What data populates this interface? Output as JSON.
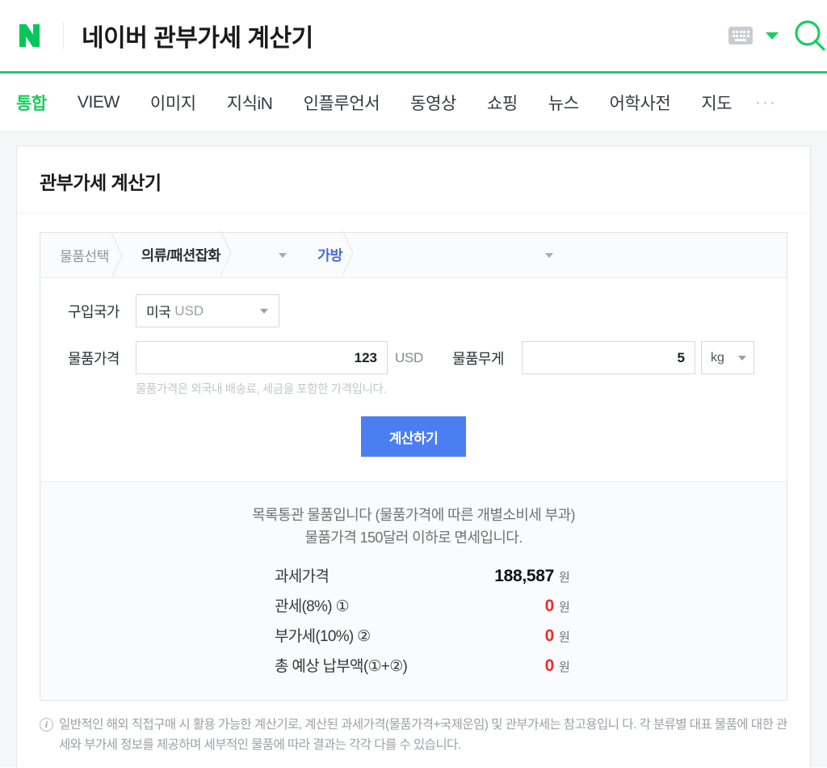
{
  "header": {
    "logo": "naver-n-logo",
    "title": "네이버 관부가세 계산기",
    "keyboard_icon": "keyboard-icon",
    "dropdown_icon": "chevron-down-icon",
    "search_icon": "search-icon",
    "accent_green": "#19ce60"
  },
  "nav": {
    "items": [
      {
        "label": "통합",
        "active": true
      },
      {
        "label": "VIEW",
        "active": false
      },
      {
        "label": "이미지",
        "active": false
      },
      {
        "label": "지식iN",
        "active": false
      },
      {
        "label": "인플루언서",
        "active": false
      },
      {
        "label": "동영상",
        "active": false
      },
      {
        "label": "쇼핑",
        "active": false
      },
      {
        "label": "뉴스",
        "active": false
      },
      {
        "label": "어학사전",
        "active": false
      },
      {
        "label": "지도",
        "active": false
      }
    ],
    "more": "···"
  },
  "card": {
    "title": "관부가세 계산기"
  },
  "breadcrumb": {
    "label": "물품선택",
    "category": "의류/패션잡화",
    "subcategory": "가방",
    "subcategory_color": "#4a6ed8"
  },
  "form": {
    "country_label": "구입국가",
    "country_value": "미국",
    "country_currency": "USD",
    "price_label": "물품가격",
    "price_value": "123",
    "price_unit": "USD",
    "weight_label": "물품무게",
    "weight_value": "5",
    "weight_unit": "kg",
    "helper_text": "물품가격은 외국내 배송료, 세금을 포함한 가격입니다.",
    "submit_label": "계산하기",
    "submit_color": "#4c7ef3"
  },
  "result": {
    "notice_line1": "목록통관 물품입니다 (물품가격에 따른 개별소비세 부과)",
    "notice_line2": "물품가격 150달러 이하로 면세입니다.",
    "currency_suffix": "원",
    "rows": [
      {
        "label": "과세가격",
        "value": "188,587",
        "color": "black"
      },
      {
        "label": "관세(8%) ①",
        "value": "0",
        "color": "red"
      },
      {
        "label": "부가세(10%) ②",
        "value": "0",
        "color": "red"
      },
      {
        "label": "총 예상 납부액(①+②)",
        "value": "0",
        "color": "red"
      }
    ]
  },
  "note": {
    "icon": "info-icon",
    "line1": "일반적인 해외 직접구매 시 활용 가능한 계산기로, 계산된 과세가격(물품가격+국제운임) 및 관부가세는 참고용입니",
    "line2": "다. 각 분류별 대표 물품에 대한 관세와 부가세 정보를 제공하며 세부적인 물품에 따라 결과는 각각 다를 수 있습니다."
  }
}
